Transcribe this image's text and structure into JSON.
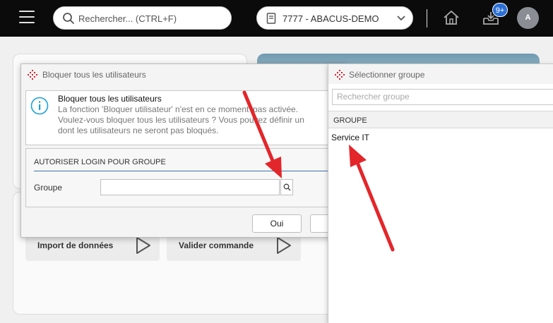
{
  "topbar": {
    "search_placeholder": "Rechercher... (CTRL+F)",
    "mandate": "7777 - ABACUS-DEMO",
    "notifications_count": "9+",
    "avatar_initial": "A"
  },
  "tiles": [
    {
      "label": "Import de données"
    },
    {
      "label": "Valider commande"
    }
  ],
  "dialog": {
    "title": "Bloquer tous les utilisateurs",
    "info_title": "Bloquer tous les utilisateurs",
    "info_lines": [
      "La fonction 'Bloquer utilisateur' n'est en ce moment' pas activée.",
      "Voulez-vous bloquer tous les utilisateurs ? Vous pouvez définir un",
      "dont les utilisateurs ne seront pas bloqués."
    ],
    "group_section_title": "AUTORISER LOGIN POUR GROUPE",
    "group_label": "Groupe",
    "group_value": "",
    "ok_label": "Oui"
  },
  "picker": {
    "title": "Sélectionner groupe",
    "search_placeholder": "Rechercher groupe",
    "column_header": "GROUPE",
    "rows": [
      "Service IT"
    ]
  },
  "colors": {
    "topbar": "#0b0b0b",
    "accent_blue": "#2b6fd6",
    "annotation_arrow": "#e3262a",
    "logo_red": "#d3242e"
  }
}
